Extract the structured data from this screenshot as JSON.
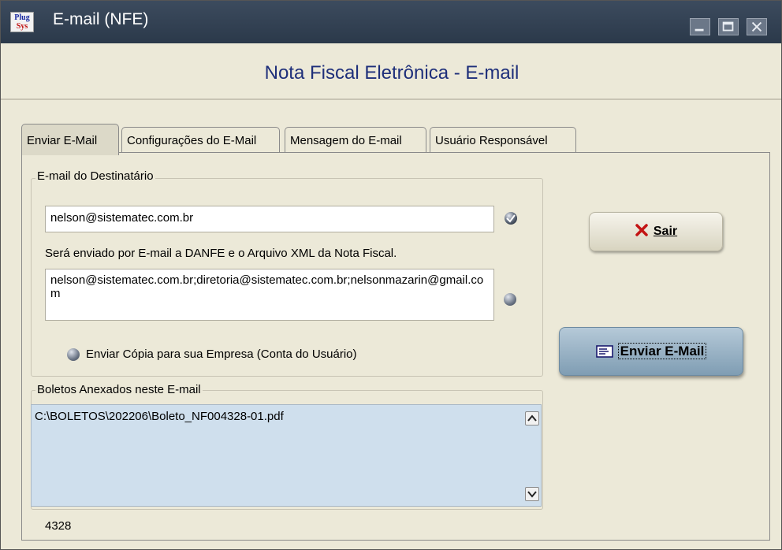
{
  "window": {
    "title": "E-mail (NFE)",
    "app_icon_text_top": "Plug",
    "app_icon_text_bottom": "Sys"
  },
  "header": {
    "title": "Nota Fiscal Eletrônica - E-mail"
  },
  "tabs": [
    {
      "label": "Enviar E-Mail",
      "active": true
    },
    {
      "label": "Configurações do E-Mail",
      "active": false
    },
    {
      "label": "Mensagem do E-mail",
      "active": false
    },
    {
      "label": "Usuário Responsável",
      "active": false
    }
  ],
  "recipient_group": {
    "label": "E-mail do Destinatário",
    "email": "nelson@sistematec.com.br",
    "info_text": "Será enviado por E-mail a DANFE e o Arquivo XML da Nota Fiscal.",
    "emails_list": "nelson@sistematec.com.br;diretoria@sistematec.com.br;nelsonmazarin@gmail.com",
    "copy_option_label": "Enviar Cópia para sua Empresa (Conta do Usuário)"
  },
  "attachments_group": {
    "label": "Boletos Anexados neste E-mail",
    "items": [
      "C:\\BOLETOS\\202206\\Boleto_NF004328-01.pdf"
    ]
  },
  "footer": {
    "code": "4328"
  },
  "buttons": {
    "sair": "Sair",
    "enviar": "Enviar E-Mail"
  },
  "colors": {
    "titlebar": "#2f3d4f",
    "header_title": "#1e2f7a",
    "listbox": "#cfdfed",
    "enviar_button": "#8faabd"
  }
}
